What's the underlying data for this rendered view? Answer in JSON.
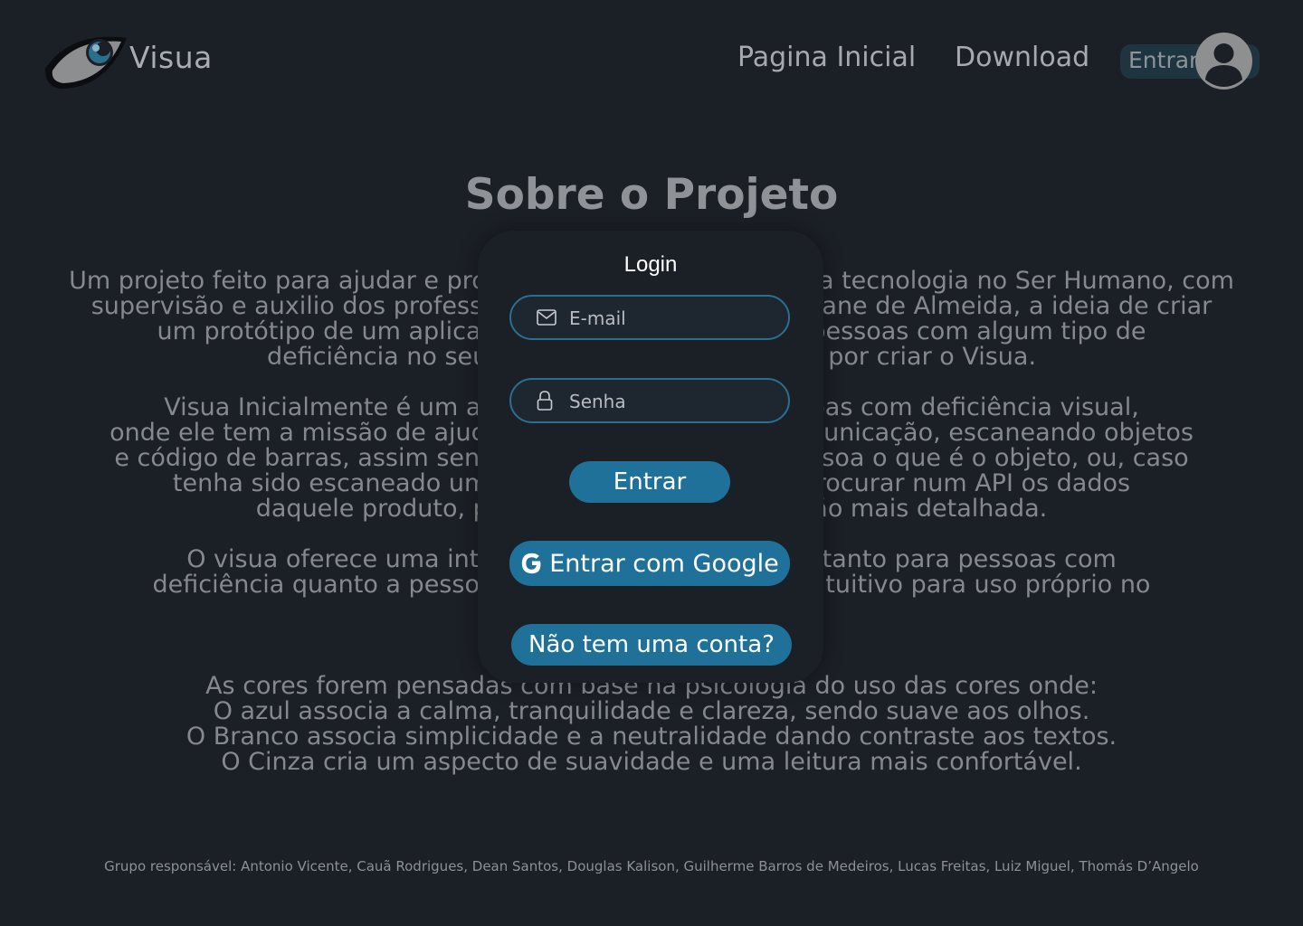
{
  "brand": {
    "name": "Visua"
  },
  "nav": {
    "home": "Pagina Inicial",
    "download": "Download",
    "login": "Entrar"
  },
  "main": {
    "title": "Sobre o Projeto",
    "paragraphs": [
      "Um projeto feito para ajudar e promover a inclusão através da tecnologia no Ser Humano, com\nsupervisão e auxilio dos professores Thiago Teodoro e Cristiane de Almeida, a ideia de criar\num protótipo de um aplicativo que ajude e auxilie as pessoas com algum tipo de\ndeficiência no seu dia a dia, assim acabamos por criar o Visua.",
      "Visua Inicialmente é um aplicativo voltado para pessoas com deficiência visual,\nonde ele tem a missão de ajudar na sua locomoção e comunicação, escaneando objetos\ne código de barras, assim sendo possível dizer para a pessoa o que é o objeto, ou, caso\ntenha sido escaneado um código de barras, ele irá procurar num API os dados\ndaquele produto, para retornar uma informação mais detalhada.",
      "O visua oferece uma interface amigável e intuitiva, tanto para pessoas com\ndeficiência quanto a pessoas sem deficiência, sendo intuitivo para uso próprio no\ndia a dia.",
      "As cores forem pensadas com base na psicologia do uso das cores onde:\nO azul associa a calma, tranquilidade e clareza, sendo suave aos olhos.\nO Branco associa simplicidade e a neutralidade dando contraste aos textos.\nO Cinza cria um aspecto de suavidade e uma leitura mais confortável."
    ]
  },
  "footer": {
    "text": "Grupo responsável: Antonio Vicente, Cauã Rodrigues, Dean Santos, Douglas Kalison, Guilherme Barros de Medeiros, Lucas Freitas, Luiz Miguel, Thomás D’Angelo"
  },
  "modal": {
    "title": "Login",
    "email_placeholder": "E-mail",
    "password_placeholder": "Senha",
    "submit_label": "Entrar",
    "google_label": "Entrar com Google",
    "signup_label": "Não tem uma conta?"
  },
  "colors": {
    "background": "#1b1f26",
    "accent": "#1f7199",
    "field_border": "#2a6f92"
  },
  "icons": [
    "eye-logo-icon",
    "user-avatar-icon",
    "mail-icon",
    "lock-icon",
    "google-icon"
  ]
}
